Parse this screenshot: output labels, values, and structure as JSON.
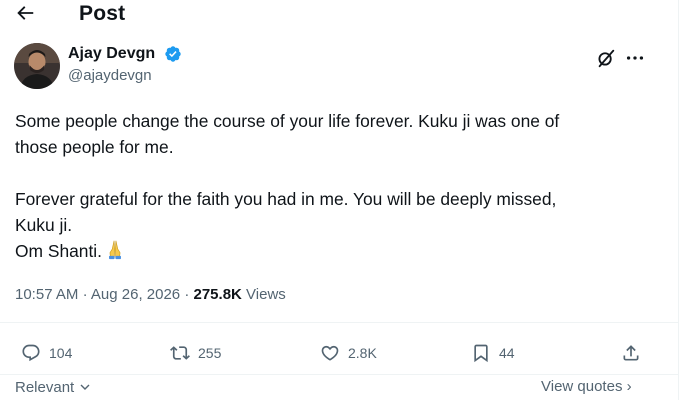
{
  "header": {
    "title": "Post",
    "back_icon": "arrow-left-icon"
  },
  "author": {
    "name": "Ajay Devgn",
    "handle": "@ajaydevgn",
    "verified": true,
    "verified_color": "#1d9bf0"
  },
  "tweet": {
    "lines": [
      "Some people change the course of your life forever. Kuku ji was one of",
      "those people for me.",
      "Forever grateful for the faith you had in me. You will be deeply missed,",
      "Kuku ji.",
      "Om Shanti."
    ],
    "emoji": "folded-hands-icon"
  },
  "meta": {
    "time": "10:57 AM",
    "separator": "·",
    "date": "Aug 26, 2026",
    "views_count": "275.8K",
    "views_label": "Views"
  },
  "actions": {
    "replies": "104",
    "reposts": "255",
    "likes": "2.8K",
    "bookmarks": "44"
  },
  "footer": {
    "sort_label": "Relevant",
    "view_quotes_label": "View quotes",
    "view_quotes_arrow": "›"
  },
  "colors": {
    "text": "#0f1419",
    "secondary": "#536471",
    "border": "#eff3f4",
    "accent": "#1d9bf0"
  }
}
